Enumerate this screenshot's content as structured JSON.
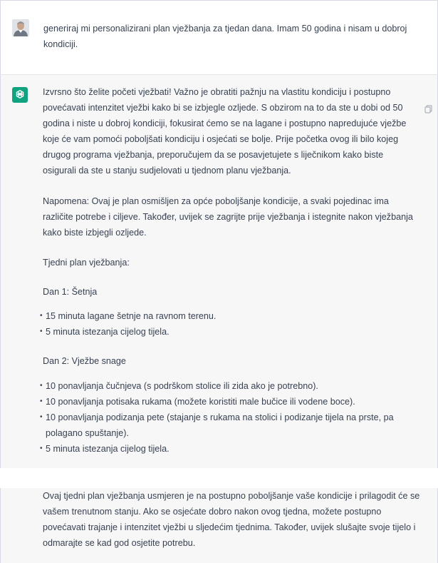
{
  "conversation": {
    "user_message": "generiraj mi personalizirani plan vježbanja za tjedan dana. Imam 50 godina i nisam u dobroj kondiciji.",
    "assistant": {
      "intro": "Izvrsno što želite početi vježbati! Važno je obratiti pažnju na vlastitu kondiciju i postupno povećavati intenzitet vježbi kako bi se izbjegle ozljede. S obzirom na to da ste u dobi od 50 godina i niste u dobroj kondiciji, fokusirat ćemo se na lagane i postupno napredujuće vježbe koje će vam pomoći poboljšati kondiciju i osjećati se bolje. Prije početka ovog ili bilo kojeg drugog programa vježbanja, preporučujem da se posavjetujete s liječnikom kako biste osigurali da ste u stanju sudjelovati u tjednom planu vježbanja.",
      "note": "Napomena: Ovaj je plan osmišljen za opće poboljšanje kondicije, a svaki pojedinac ima različite potrebe i ciljeve. Također, uvijek se zagrijte prije vježbanja i istegnite nakon vježbanja kako biste izbjegli ozljede.",
      "plan_heading": "Tjedni plan vježbanja:",
      "day1_title": "Dan 1: Šetnja",
      "day1_items": [
        "15 minuta lagane šetnje na ravnom terenu.",
        "5 minuta istezanja cijelog tijela."
      ],
      "day2_title": "Dan 2: Vježbe snage",
      "day2_items": [
        "10 ponavljanja čučnjeva (s podrškom stolice ili zida ako je potrebno).",
        "10 ponavljanja potisaka rukama (možete koristiti male bučice ili vodene boce).",
        "10 ponavljanja podizanja pete (stajanje s rukama na stolici i podizanje tijela na prste, pa polagano spuštanje).",
        "5 minuta istezanja cijelog tijela."
      ],
      "closing": "Ovaj tjedni plan vježbanja usmjeren je na postupno poboljšanje vaše kondicije i prilagodit će se vašem trenutnom stanju. Ako se osjećate dobro nakon ovog tjedna, možete postupno povećavati trajanje i intenzitet vježbi u sljedećim tjednima. Također, uvijek slušajte svoje tijelo i odmarajte se kad god osjetite potrebu."
    }
  },
  "icons": {
    "user_avatar": "user-avatar",
    "assistant_logo": "openai-logo-icon",
    "copy": "copy-icon"
  },
  "colors": {
    "assistant_bg": "#f7f7f8",
    "brand_green": "#10a37f",
    "text": "#374151"
  }
}
